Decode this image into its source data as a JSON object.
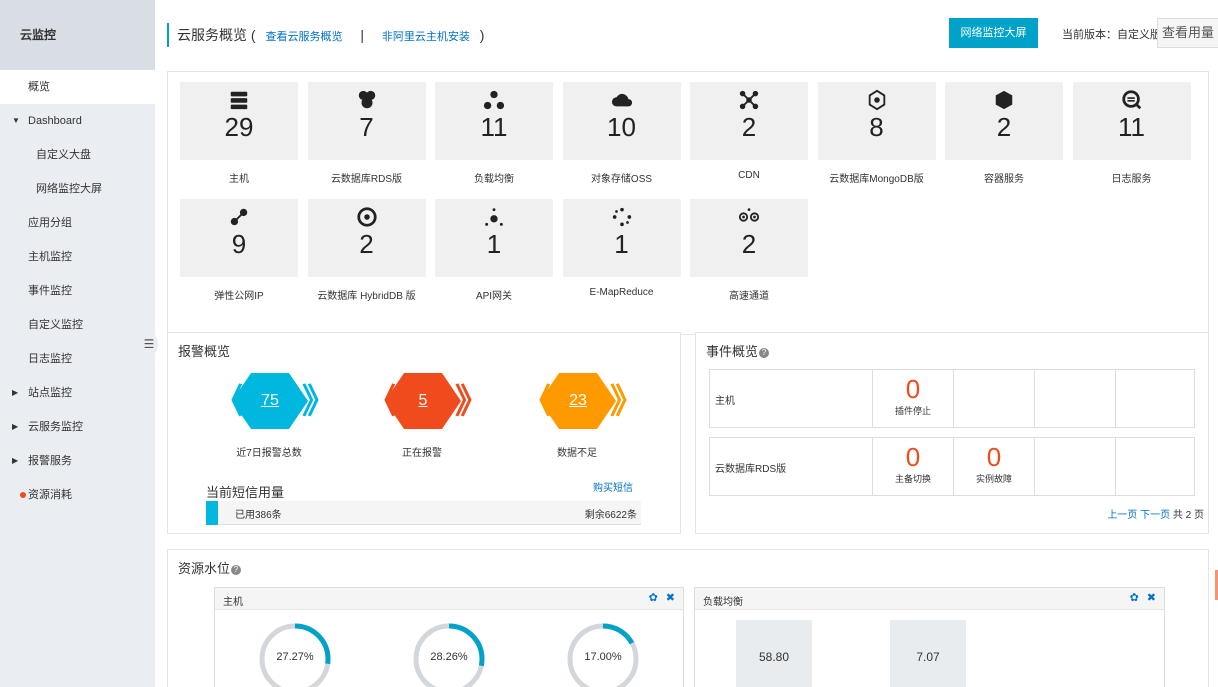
{
  "sidebar": {
    "title": "云监控",
    "items": [
      {
        "label": "概览",
        "kind": "top",
        "active": true
      },
      {
        "label": "Dashboard",
        "kind": "group",
        "caret": "▼"
      },
      {
        "label": "自定义大盘",
        "kind": "sub"
      },
      {
        "label": "网络监控大屏",
        "kind": "sub"
      },
      {
        "label": "应用分组",
        "kind": "top"
      },
      {
        "label": "主机监控",
        "kind": "top"
      },
      {
        "label": "事件监控",
        "kind": "top"
      },
      {
        "label": "自定义监控",
        "kind": "top"
      },
      {
        "label": "日志监控",
        "kind": "top"
      },
      {
        "label": "站点监控",
        "kind": "group",
        "caret": "▶"
      },
      {
        "label": "云服务监控",
        "kind": "group",
        "caret": "▶"
      },
      {
        "label": "报警服务",
        "kind": "group",
        "caret": "▶"
      },
      {
        "label": "资源消耗",
        "kind": "dot"
      }
    ]
  },
  "header": {
    "title": "云服务概览",
    "paren_open": "(",
    "link_view": "查看云服务概览",
    "separator": "|",
    "link_install": "非阿里云主机安装",
    "paren_close": ")",
    "big_screen_button": "网络监控大屏",
    "version_text": "当前版本：自定义版",
    "usage_button": "查看用量"
  },
  "services": [
    {
      "count": "29",
      "label": "主机",
      "icon": "server-icon"
    },
    {
      "count": "7",
      "label": "云数据库RDS版",
      "icon": "rds-icon"
    },
    {
      "count": "11",
      "label": "负载均衡",
      "icon": "load-balancer-icon"
    },
    {
      "count": "10",
      "label": "对象存储OSS",
      "icon": "oss-icon"
    },
    {
      "count": "2",
      "label": "CDN",
      "icon": "cdn-icon"
    },
    {
      "count": "8",
      "label": "云数据库MongoDB版",
      "icon": "mongodb-icon"
    },
    {
      "count": "2",
      "label": "容器服务",
      "icon": "container-icon"
    },
    {
      "count": "11",
      "label": "日志服务",
      "icon": "log-service-icon"
    },
    {
      "count": "9",
      "label": "弹性公网IP",
      "icon": "eip-icon"
    },
    {
      "count": "2",
      "label": "云数据库 HybridDB 版",
      "icon": "hybriddb-icon"
    },
    {
      "count": "1",
      "label": "API网关",
      "icon": "api-gateway-icon"
    },
    {
      "count": "1",
      "label": "E-MapReduce",
      "icon": "emapreduce-icon"
    },
    {
      "count": "2",
      "label": "高速通道",
      "icon": "express-connect-icon"
    }
  ],
  "alarm": {
    "title": "报警概览",
    "stats": [
      {
        "value": "75",
        "label": "近7日报警总数",
        "color": "#00b7e0"
      },
      {
        "value": "5",
        "label": "正在报警",
        "color": "#f04b1d"
      },
      {
        "value": "23",
        "label": "数据不足",
        "color": "#ff9900"
      }
    ],
    "sms_title": "当前短信用量",
    "sms_buy": "购买短信",
    "sms_used": "已用386条",
    "sms_left": "剩余6622条"
  },
  "events": {
    "title": "事件概览",
    "rows": [
      {
        "name": "主机",
        "cells": [
          {
            "num": "0",
            "label": "插件停止"
          }
        ]
      },
      {
        "name": "云数据库RDS版",
        "cells": [
          {
            "num": "0",
            "label": "主备切换"
          },
          {
            "num": "0",
            "label": "实例故障"
          }
        ]
      }
    ],
    "prev": "上一页",
    "next": "下一页",
    "total": "共 2 页"
  },
  "resource": {
    "title": "资源水位",
    "host_panel": {
      "title": "主机",
      "gauges": [
        {
          "text": "27.27%",
          "value": 27.27
        },
        {
          "text": "28.26%",
          "value": 28.26
        },
        {
          "text": "17.00%",
          "value": 17.0
        }
      ]
    },
    "lb_panel": {
      "title": "负载均衡",
      "values": [
        "58.80",
        "7.07"
      ]
    },
    "gear_icon": "gear-icon",
    "close_icon": "close-icon"
  },
  "colors": {
    "accent": "#00a2ca",
    "alarm_blue": "#00b7e0",
    "alarm_red": "#f04b1d",
    "alarm_orange": "#ff9900",
    "link": "#0070cc"
  }
}
